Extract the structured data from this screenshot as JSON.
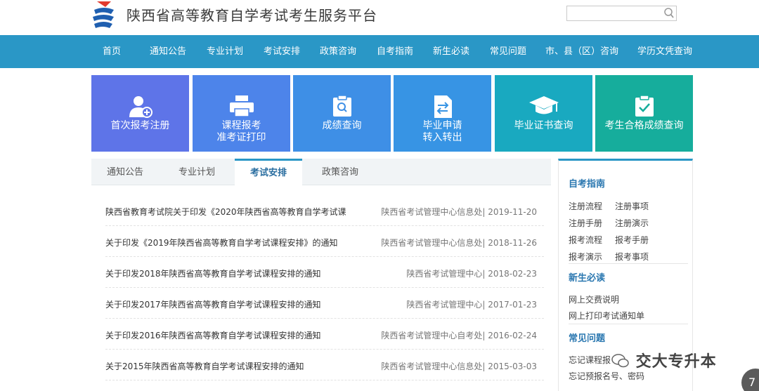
{
  "header": {
    "site_title": "陕西省高等教育自学考试考生服务平台",
    "search_placeholder": ""
  },
  "nav": [
    "首页",
    "通知公告",
    "专业计划",
    "考试安排",
    "政策咨询",
    "自考指南",
    "新生必读",
    "常见问题",
    "市、县（区）咨询",
    "学历文凭查询"
  ],
  "tiles": [
    {
      "line1": "首次报考注册",
      "line2": "",
      "color": "#5e74e8"
    },
    {
      "line1": "课程报考",
      "line2": "准考证打印",
      "color": "#4d84ea"
    },
    {
      "line1": "成绩查询",
      "line2": "",
      "color": "#3e8fe6"
    },
    {
      "line1": "毕业申请",
      "line2": "转入转出",
      "color": "#3794e4"
    },
    {
      "line1": "毕业证书查询",
      "line2": "",
      "color": "#19a9c0"
    },
    {
      "line1": "考生合格成绩查询",
      "line2": "",
      "color": "#16ad9c"
    }
  ],
  "tabs": [
    "通知公告",
    "专业计划",
    "考试安排",
    "政策咨询"
  ],
  "active_tab": "考试安排",
  "news": [
    {
      "title": "陕西省教育考试院关于印发《2020年陕西省高等教育自学考试课",
      "source": "陕西省考试管理中心信息处| 2019-11-20"
    },
    {
      "title": "关于印发《2019年陕西省高等教育自学考试课程安排》的通知",
      "source": "陕西省考试管理中心信息处| 2018-11-26"
    },
    {
      "title": "关于印发2018年陕西省高等教育自学考试课程安排的通知",
      "source": "陕西省考试管理中心| 2018-02-23"
    },
    {
      "title": "关于印发2017年陕西省高等教育自学考试课程安排的通知",
      "source": "陕西省考试管理中心| 2017-01-23"
    },
    {
      "title": "关于印发2016年陕西省高等教育自学考试课程安排的通知",
      "source": "陕西省考试管理中心自考处| 2016-02-24"
    },
    {
      "title": "关于2015年陕西省高等教育自学考试课程安排的通知",
      "source": "陕西省考试管理中心信息处| 2015-03-03"
    }
  ],
  "side": {
    "guide_title": "自考指南",
    "guide_links": [
      "注册流程",
      "注册事项",
      "注册手册",
      "注册演示",
      "报考流程",
      "报考手册",
      "报考演示",
      "报考事项"
    ],
    "newbie_title": "新生必读",
    "newbie_links": [
      "网上交费说明",
      "网上打印考试通知单"
    ],
    "faq_title": "常见问题",
    "faq_links": [
      "忘记课程报",
      "忘记预报名号、密码"
    ]
  },
  "watermark": "交大专升本",
  "corner_badge": "7",
  "colors": {
    "nav": "#2a97c6",
    "accent": "#2a77b0"
  }
}
